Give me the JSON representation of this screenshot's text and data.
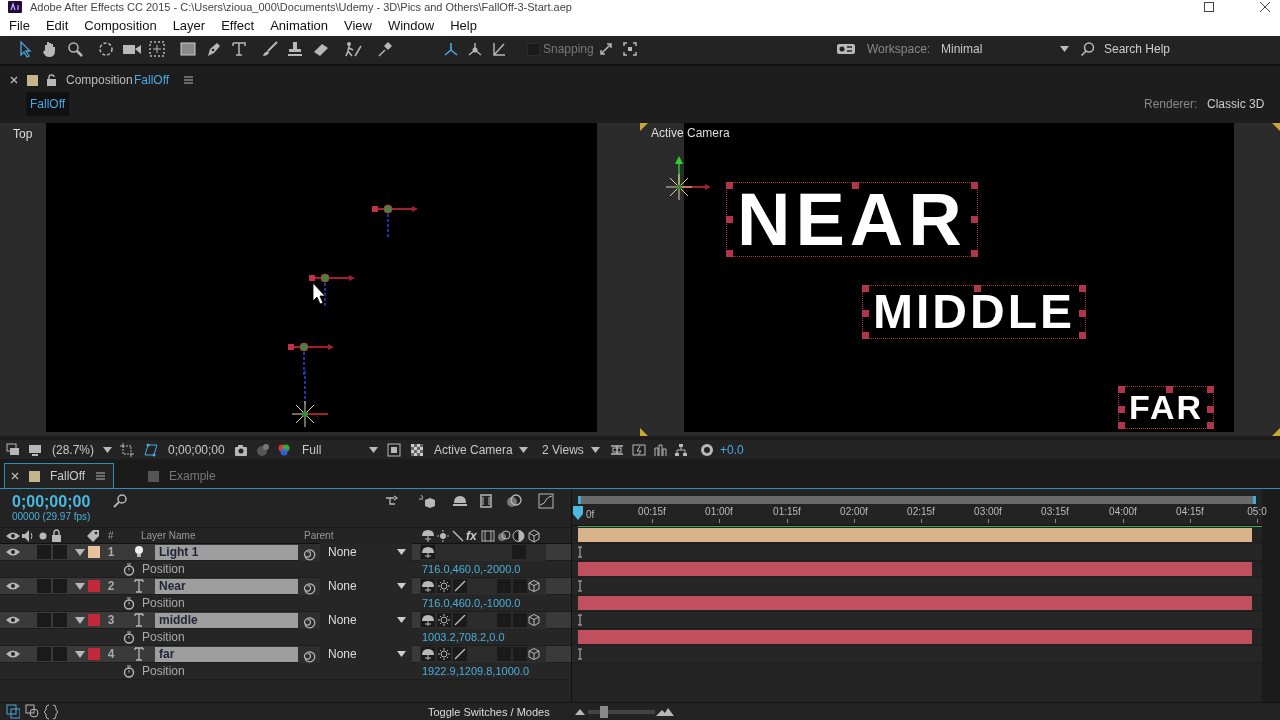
{
  "window": {
    "title": "Adobe After Effects CC 2015 - C:\\Users\\zioua_000\\Documents\\Udemy - 3D\\Pics and Others\\FallOff-3-Start.aep"
  },
  "menu": [
    "File",
    "Edit",
    "Composition",
    "Layer",
    "Effect",
    "Animation",
    "View",
    "Window",
    "Help"
  ],
  "toolbar": {
    "snapping": {
      "label": "Snapping",
      "checked": false
    },
    "workspace_label": "Workspace:",
    "workspace": "Minimal",
    "search": {
      "placeholder": "Search Help"
    }
  },
  "composition_panel": {
    "title": "Composition",
    "name": "FallOff",
    "tabs": [
      {
        "label": "FallOff",
        "selected": true
      }
    ],
    "renderer_label": "Renderer:",
    "renderer": "Classic 3D",
    "views": [
      {
        "kind": "top",
        "label": "Top"
      },
      {
        "kind": "camera",
        "label": "Active Camera",
        "texts": [
          "NEAR",
          "MIDDLE",
          "FAR"
        ]
      }
    ],
    "viewer_bar": {
      "zoom": "(28.7%)",
      "timecode": "0;00;00;00",
      "resolution": "Full",
      "view": "Active Camera",
      "layout": "2 Views",
      "exposure": "+0.0"
    }
  },
  "timeline": {
    "tabs": [
      {
        "label": "FallOff",
        "selected": true
      },
      {
        "label": "Example",
        "selected": false
      }
    ],
    "timecode": "0;00;00;00",
    "frame_info": "00000 (29.97 fps)",
    "ruler": [
      "0f",
      "00:15f",
      "01:00f",
      "01:15f",
      "02:00f",
      "02:15f",
      "03:00f",
      "03:15f",
      "04:00f",
      "04:15f",
      "05:0"
    ],
    "columns": {
      "number": "#",
      "name": "Layer Name",
      "parent": "Parent",
      "effects": "fx"
    },
    "layers": [
      {
        "number": "1",
        "name": "Light 1",
        "kind": "light",
        "color": "#e8c29c",
        "selected": true,
        "expanded": true,
        "parent": "None",
        "property": "Position",
        "value": "716.0,460.0,-2000.0"
      },
      {
        "number": "2",
        "name": "Near",
        "kind": "text",
        "color": "#c3283a",
        "selected": true,
        "expanded": true,
        "parent": "None",
        "property": "Position",
        "value": "716.0,460.0,-1000.0"
      },
      {
        "number": "3",
        "name": "middle",
        "kind": "text",
        "color": "#c3283a",
        "selected": true,
        "expanded": true,
        "parent": "None",
        "property": "Position",
        "value": "1003.2,708.2,0.0"
      },
      {
        "number": "4",
        "name": "far",
        "kind": "text",
        "color": "#c3283a",
        "selected": true,
        "expanded": true,
        "parent": "None",
        "property": "Position",
        "value": "1922.9,1209.8,1000.0"
      }
    ],
    "footer_toggle": "Toggle Switches / Modes",
    "zoom_slider": {
      "level": 0.2
    }
  }
}
